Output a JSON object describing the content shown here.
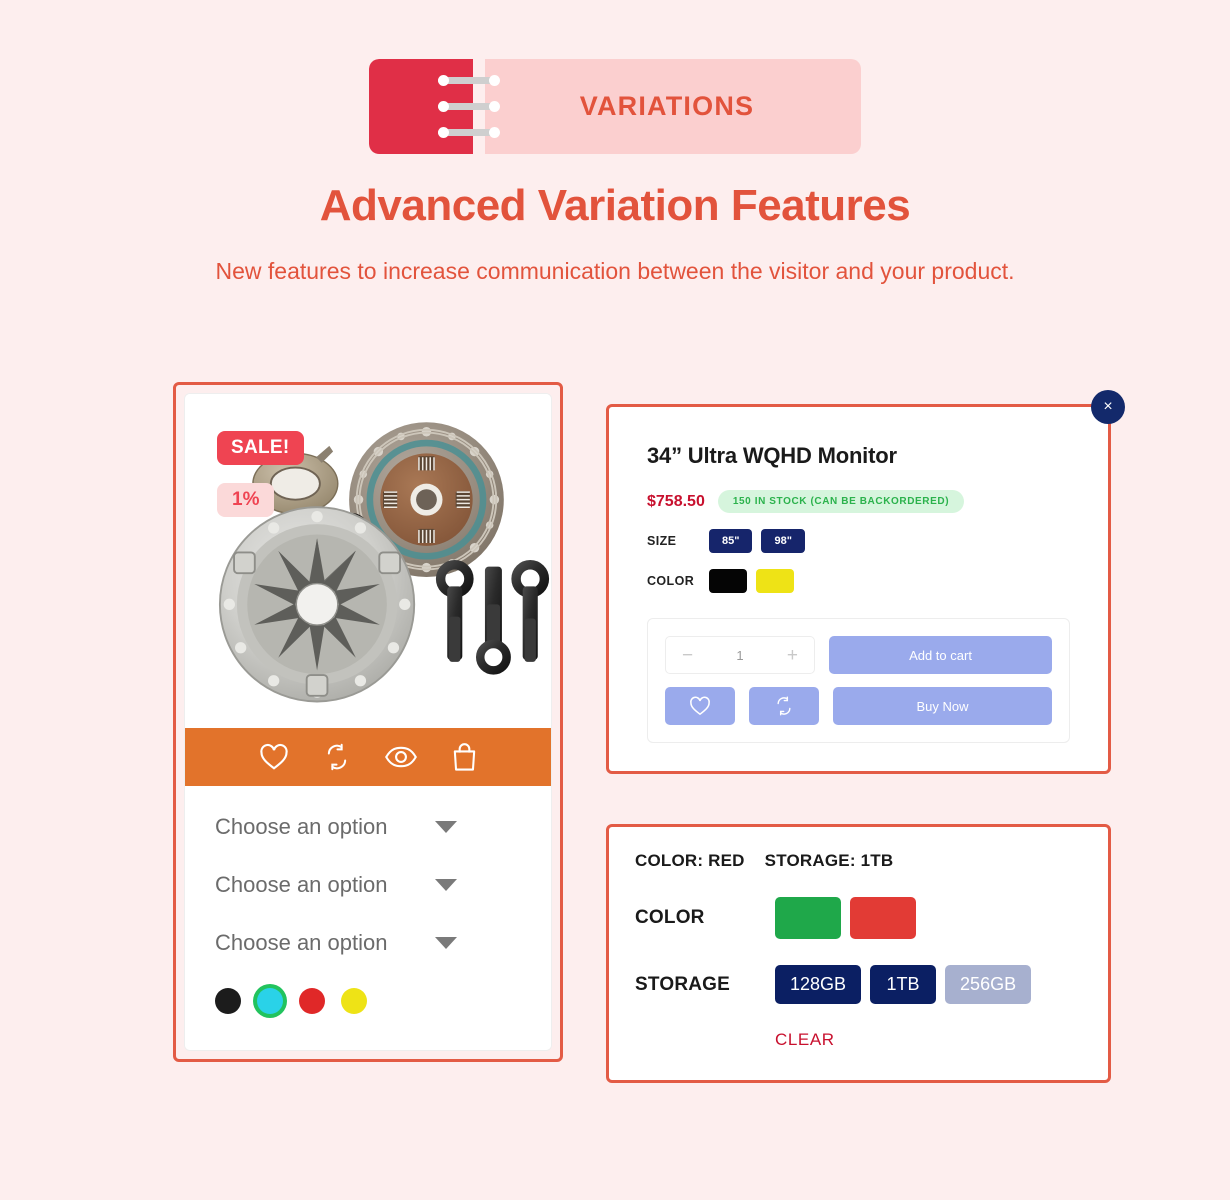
{
  "header": {
    "badge_label": "VARIATIONS",
    "title": "Advanced Variation Features",
    "subtitle": "New features to increase communication between the visitor and your product.",
    "accent_color": "#e2533c",
    "badge_bg": "#fbcfcf",
    "badge_spine": "#e02f47",
    "page_bg": "#fdeeee"
  },
  "product_card": {
    "sale_badge": "SALE!",
    "discount_badge": "1%",
    "image_alt": "clutch-kit",
    "action_icons": [
      {
        "name": "wishlist-icon",
        "glyph": "heart"
      },
      {
        "name": "compare-icon",
        "glyph": "compare"
      },
      {
        "name": "quick-view-icon",
        "glyph": "eye"
      },
      {
        "name": "add-to-cart-icon",
        "glyph": "bag"
      }
    ],
    "action_bar_color": "#e2732b",
    "dropdowns": [
      {
        "label": "Choose an option"
      },
      {
        "label": "Choose an option"
      },
      {
        "label": "Choose an option"
      }
    ],
    "swatches": [
      {
        "name": "black",
        "color": "#1c1c1c",
        "selected": false
      },
      {
        "name": "cyan",
        "color": "#2ad2e8",
        "selected": true
      },
      {
        "name": "red",
        "color": "#e02828",
        "selected": false
      },
      {
        "name": "yellow",
        "color": "#eee316",
        "selected": false
      }
    ],
    "frame_color": "#e35b45"
  },
  "quick_view": {
    "close_label": "×",
    "title": "34” Ultra WQHD Monitor",
    "price": "$758.50",
    "price_color": "#c8102e",
    "stock_label": "150 IN STOCK (CAN BE BACKORDERED)",
    "stock_bg": "#d6f5dd",
    "stock_color": "#2bb24c",
    "attributes": [
      {
        "name": "SIZE",
        "type": "text",
        "values": [
          {
            "label": "85\"",
            "color": "#16256b"
          },
          {
            "label": "98\"",
            "color": "#16256b"
          }
        ]
      },
      {
        "name": "COLOR",
        "type": "swatch",
        "values": [
          {
            "label": "black",
            "color": "#050505"
          },
          {
            "label": "yellow",
            "color": "#eee316"
          }
        ]
      }
    ],
    "quantity": {
      "minus": "−",
      "value": "1",
      "plus": "+"
    },
    "add_to_cart_label": "Add to cart",
    "buy_now_label": "Buy Now",
    "wishlist_icon": "heart-icon",
    "compare_icon": "compare-icon",
    "button_color": "#9aaaec"
  },
  "variation_panel": {
    "selected_summary": [
      "COLOR: RED",
      "STORAGE: 1TB"
    ],
    "attributes": [
      {
        "name": "COLOR",
        "type": "swatch",
        "values": [
          {
            "label": "green",
            "color": "#1fa84a",
            "state": "available"
          },
          {
            "label": "red",
            "color": "#e23b35",
            "state": "selected"
          }
        ]
      },
      {
        "name": "STORAGE",
        "type": "text",
        "values": [
          {
            "label": "128GB",
            "color": "#0b1f63",
            "state": "available"
          },
          {
            "label": "1TB",
            "color": "#0b1f63",
            "state": "selected"
          },
          {
            "label": "256GB",
            "color": "#a7b0cf",
            "state": "disabled"
          }
        ]
      }
    ],
    "clear_label": "CLEAR",
    "clear_color": "#c8102e"
  }
}
